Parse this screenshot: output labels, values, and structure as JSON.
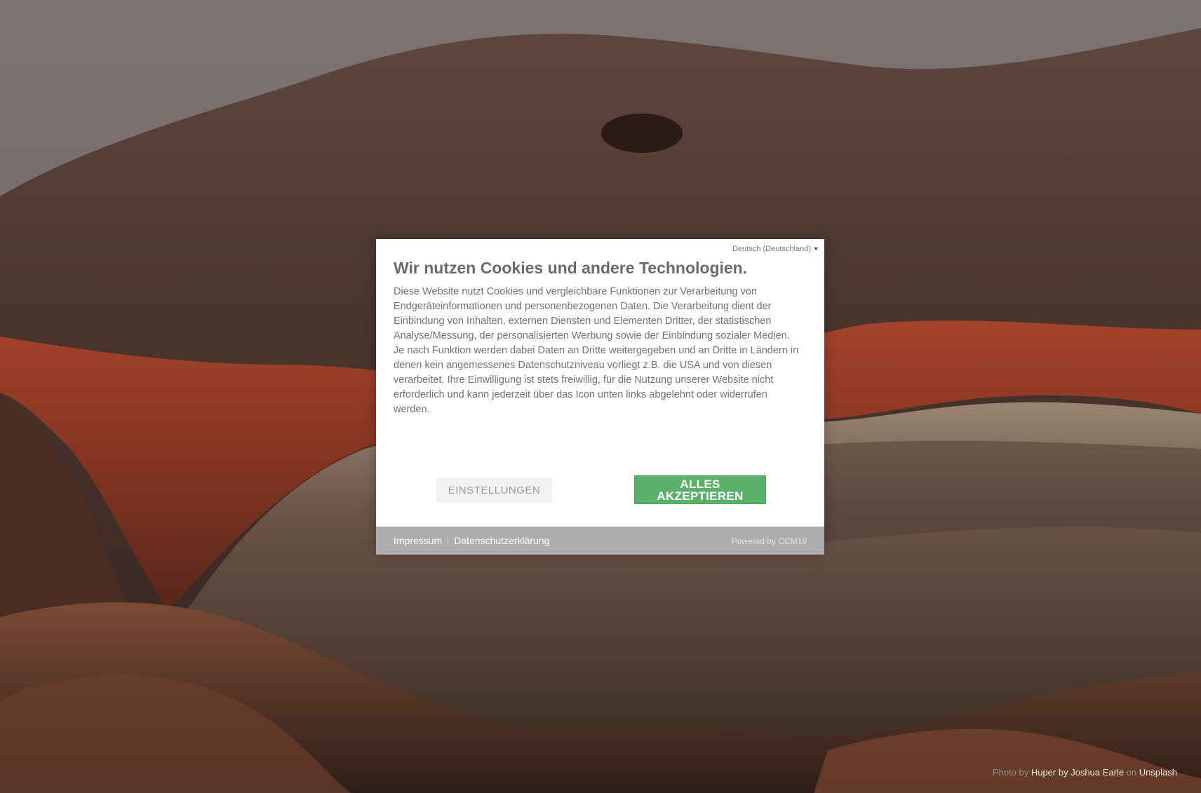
{
  "background": {
    "credit_prefix": "Photo by",
    "credit_author": "Huper by Joshua Earle",
    "credit_on": "on",
    "credit_site": "Unsplash"
  },
  "dialog": {
    "language": "Deutsch (Deutschland)",
    "title": "Wir nutzen Cookies und andere Technologien.",
    "body": "Diese Website nutzt Cookies und vergleichbare Funktionen zur Verarbeitung von Endgeräteinformationen und personenbezogenen Daten. Die Verarbeitung dient der Einbindung von Inhalten, externen Diensten und Elementen Dritter, der statistischen Analyse/Messung, der personalisierten Werbung sowie der Einbindung sozialer Medien. Je nach Funktion werden dabei Daten an Dritte weitergegeben und an Dritte in Ländern in denen kein angemessenes Datenschutzniveau vorliegt z.B. die USA und von diesen verarbeitet. Ihre Einwilligung ist stets freiwillig, für die Nutzung unserer Website nicht erforderlich und kann jederzeit über das Icon unten links abgelehnt oder widerrufen werden.",
    "settings_button": "EINSTELLUNGEN",
    "accept_button": "ALLES AKZEPTIEREN",
    "footer": {
      "imprint": "Impressum",
      "privacy": "Datenschutzerklärung",
      "powered_by": "Powered by CCM19"
    }
  }
}
